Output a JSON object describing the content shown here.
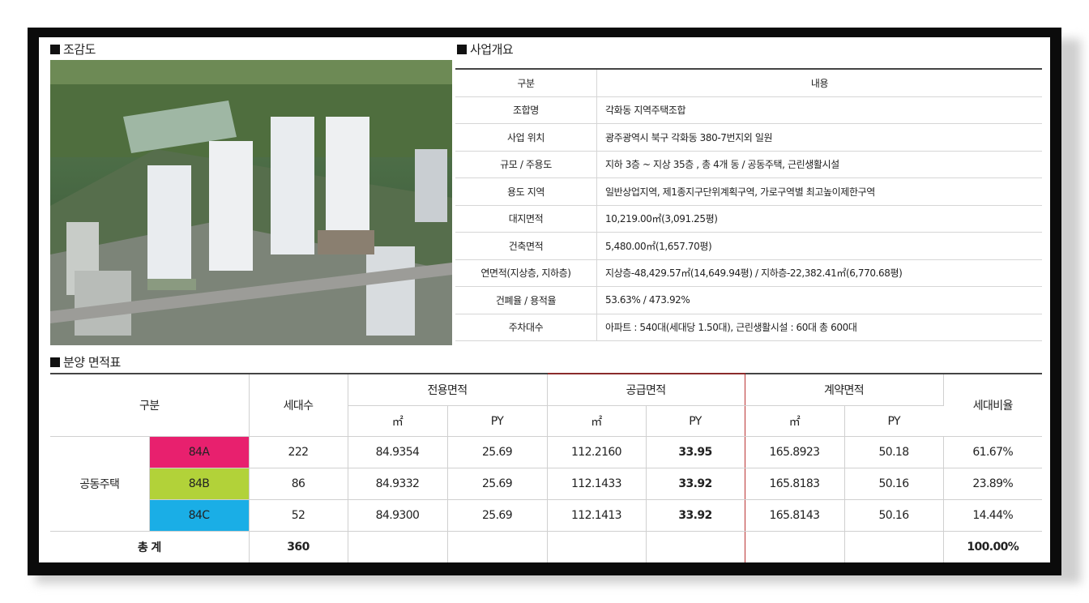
{
  "sections": {
    "aerial_title": "조감도",
    "overview_title": "사업개요",
    "area_title": "분양 면적표"
  },
  "overview": {
    "header": {
      "key": "구분",
      "value": "내용"
    },
    "rows": [
      {
        "key": "조합명",
        "value": "각화동 지역주택조합"
      },
      {
        "key": "사업 위치",
        "value": "광주광역시 북구 각화동 380-7번지외 일원"
      },
      {
        "key": "규모 / 주용도",
        "value": "지하 3층 ~ 지상 35층 , 총 4개 동 / 공동주택, 근린생활시설"
      },
      {
        "key": "용도 지역",
        "value": "일반상업지역, 제1종지구단위계획구역, 가로구역별 최고높이제한구역"
      },
      {
        "key": "대지면적",
        "value": "10,219.00㎡(3,091.25평)"
      },
      {
        "key": "건축면적",
        "value": "5,480.00㎡(1,657.70평)"
      },
      {
        "key": "연면적(지상층, 지하층)",
        "value": "지상층-48,429.57㎡(14,649.94평) / 지하층-22,382.41㎡(6,770.68평)"
      },
      {
        "key": "건폐율 / 용적율",
        "value": "53.63% / 473.92%"
      },
      {
        "key": "주차대수",
        "value": "아파트 : 540대(세대당 1.50대), 근린생활시설 : 60대 총 600대"
      }
    ]
  },
  "area": {
    "headers": {
      "category": "구분",
      "households": "세대수",
      "exclusive": "전용면적",
      "supply": "공급면적",
      "contract": "계약면적",
      "ratio": "세대비율",
      "sqm": "㎡",
      "py": "PY"
    },
    "group_label": "공동주택",
    "rows": [
      {
        "type": "84A",
        "color": "#e8206e",
        "households": "222",
        "ex_m2": "84.9354",
        "ex_py": "25.69",
        "sup_m2": "112.2160",
        "sup_py": "33.95",
        "con_m2": "165.8923",
        "con_py": "50.18",
        "ratio": "61.67%"
      },
      {
        "type": "84B",
        "color": "#b2d239",
        "households": "86",
        "ex_m2": "84.9332",
        "ex_py": "25.69",
        "sup_m2": "112.1433",
        "sup_py": "33.92",
        "con_m2": "165.8183",
        "con_py": "50.16",
        "ratio": "23.89%"
      },
      {
        "type": "84C",
        "color": "#1aaee6",
        "households": "52",
        "ex_m2": "84.9300",
        "ex_py": "25.69",
        "sup_m2": "112.1413",
        "sup_py": "33.92",
        "con_m2": "165.8143",
        "con_py": "50.16",
        "ratio": "14.44%"
      }
    ],
    "total": {
      "label": "총 계",
      "households": "360",
      "ratio": "100.00%"
    }
  }
}
